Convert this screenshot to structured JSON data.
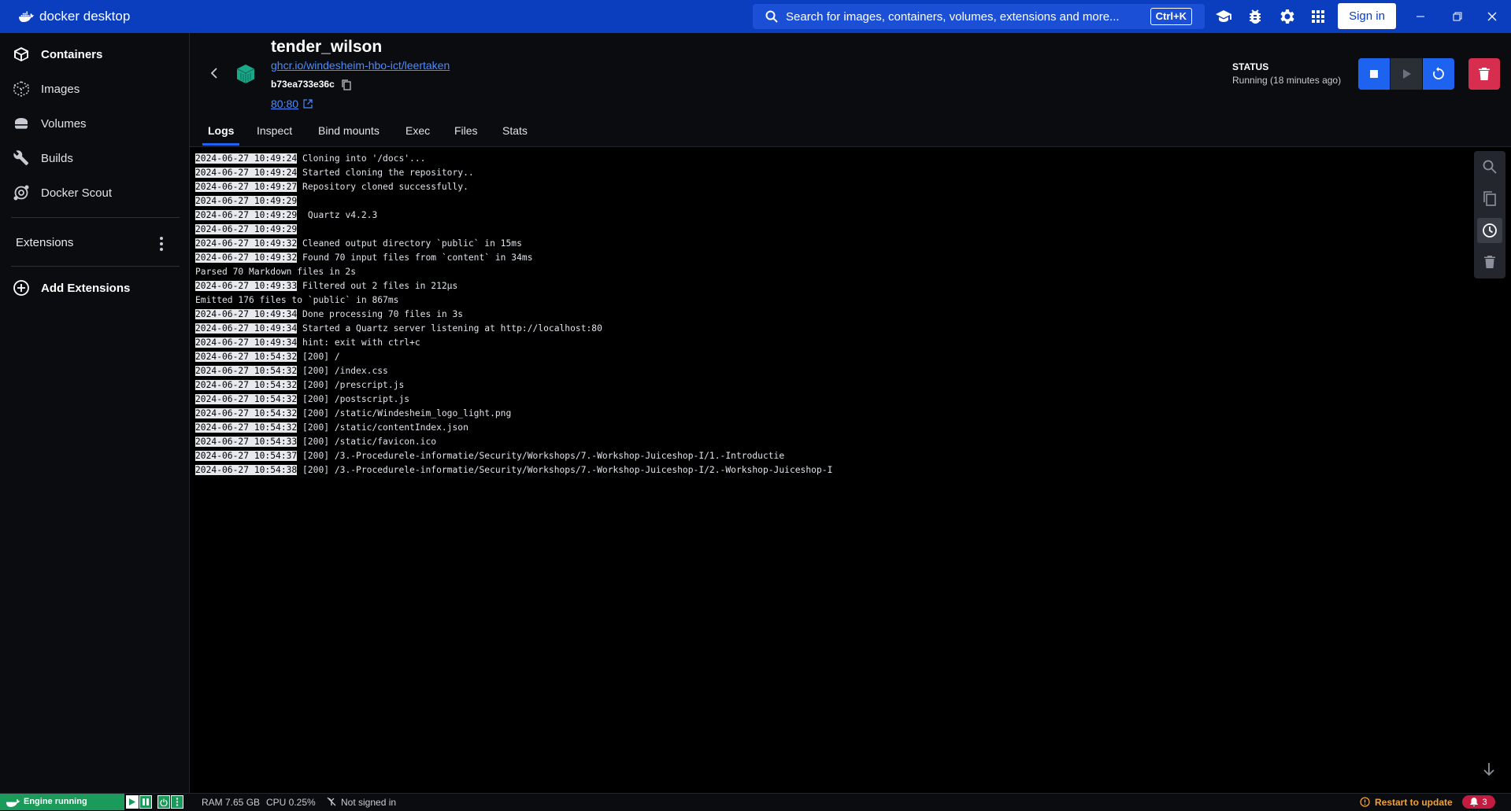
{
  "app": {
    "title": "docker desktop",
    "accent": "#0b3dbf",
    "search_placeholder": "Search for images, containers, volumes, extensions and more...",
    "search_shortcut": "Ctrl+K",
    "sign_in_label": "Sign in",
    "icons": [
      "docker-logo-icon",
      "search-icon",
      "learning-center-icon",
      "bug-icon",
      "settings-gear-icon",
      "grid-apps-icon",
      "minimize-icon",
      "restore-icon",
      "close-icon"
    ]
  },
  "sidebar": {
    "items": [
      {
        "label": "Containers",
        "icon": "containers-icon",
        "active": true
      },
      {
        "label": "Images",
        "icon": "images-icon",
        "active": false
      },
      {
        "label": "Volumes",
        "icon": "volumes-icon",
        "active": false
      },
      {
        "label": "Builds",
        "icon": "builds-wrench-icon",
        "active": false
      },
      {
        "label": "Docker Scout",
        "icon": "docker-scout-icon",
        "active": false
      }
    ],
    "extensions_label": "Extensions",
    "add_extensions_label": "Add Extensions"
  },
  "container": {
    "name": "tender_wilson",
    "image": "ghcr.io/windesheim-hbo-ict/leertaken",
    "id": "b73ea733e36c",
    "port": "80:80",
    "status_label": "STATUS",
    "status_text": "Running (18 minutes ago)",
    "status_color": "#1e63f0",
    "delete_color": "#d72d4e"
  },
  "tabs": [
    {
      "label": "Logs",
      "active": true
    },
    {
      "label": "Inspect",
      "active": false
    },
    {
      "label": "Bind mounts",
      "active": false
    },
    {
      "label": "Exec",
      "active": false
    },
    {
      "label": "Files",
      "active": false
    },
    {
      "label": "Stats",
      "active": false
    }
  ],
  "logs": [
    {
      "ts": "2024-06-27 10:49:24",
      "msg": " Cloning into '/docs'..."
    },
    {
      "ts": "2024-06-27 10:49:24",
      "msg": " Started cloning the repository.."
    },
    {
      "ts": "2024-06-27 10:49:27",
      "msg": " Repository cloned successfully."
    },
    {
      "ts": "2024-06-27 10:49:29",
      "msg": ""
    },
    {
      "ts": "2024-06-27 10:49:29",
      "msg": "  Quartz v4.2.3"
    },
    {
      "ts": "2024-06-27 10:49:29",
      "msg": ""
    },
    {
      "ts": "2024-06-27 10:49:32",
      "msg": " Cleaned output directory `public` in 15ms"
    },
    {
      "ts": "2024-06-27 10:49:32",
      "msg": " Found 70 input files from `content` in 34ms"
    },
    {
      "ts": "",
      "msg": "Parsed 70 Markdown files in 2s"
    },
    {
      "ts": "2024-06-27 10:49:33",
      "msg": " Filtered out 2 files in 212µs"
    },
    {
      "ts": "",
      "msg": "Emitted 176 files to `public` in 867ms"
    },
    {
      "ts": "2024-06-27 10:49:34",
      "msg": " Done processing 70 files in 3s"
    },
    {
      "ts": "2024-06-27 10:49:34",
      "msg": " Started a Quartz server listening at http://localhost:80"
    },
    {
      "ts": "2024-06-27 10:49:34",
      "msg": " hint: exit with ctrl+c"
    },
    {
      "ts": "2024-06-27 10:54:32",
      "msg": " [200] /"
    },
    {
      "ts": "2024-06-27 10:54:32",
      "msg": " [200] /index.css"
    },
    {
      "ts": "2024-06-27 10:54:32",
      "msg": " [200] /prescript.js"
    },
    {
      "ts": "2024-06-27 10:54:32",
      "msg": " [200] /postscript.js"
    },
    {
      "ts": "2024-06-27 10:54:32",
      "msg": " [200] /static/Windesheim_logo_light.png"
    },
    {
      "ts": "2024-06-27 10:54:32",
      "msg": " [200] /static/contentIndex.json"
    },
    {
      "ts": "2024-06-27 10:54:33",
      "msg": " [200] /static/favicon.ico"
    },
    {
      "ts": "2024-06-27 10:54:37",
      "msg": " [200] /3.-Procedurele-informatie/Security/Workshops/7.-Workshop-Juiceshop-I/1.-Introductie"
    },
    {
      "ts": "2024-06-27 10:54:38",
      "msg": " [200] /3.-Procedurele-informatie/Security/Workshops/7.-Workshop-Juiceshop-I/2.-Workshop-Juiceshop-I"
    }
  ],
  "footer": {
    "engine_status": "Engine running",
    "engine_color": "#1a9b5a",
    "ram": "RAM 7.65 GB",
    "cpu": "CPU 0.25%",
    "signin_status": "Not signed in",
    "update_text": "Restart to update",
    "update_color": "#f0a236",
    "notification_count": "3"
  }
}
